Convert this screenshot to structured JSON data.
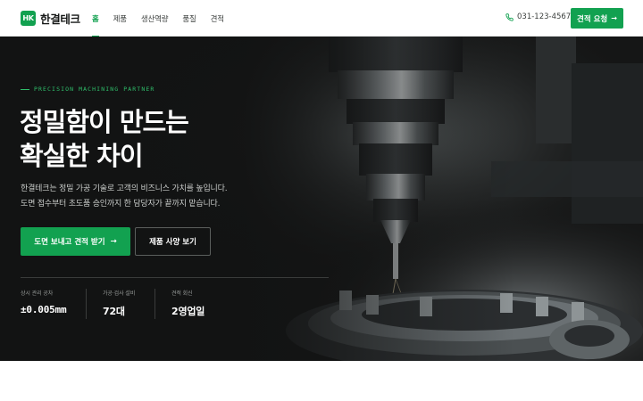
{
  "header": {
    "logo_mark": "HK",
    "brand": "한결테크",
    "nav": [
      {
        "label": "홈",
        "active": true
      },
      {
        "label": "제품",
        "active": false
      },
      {
        "label": "생산역량",
        "active": false
      },
      {
        "label": "품질",
        "active": false
      },
      {
        "label": "견적",
        "active": false
      }
    ],
    "phone": "031-123-4567",
    "quote_button": "견적 요청",
    "icons": {
      "phone": "phone-icon",
      "arrow": "arrow-right-icon"
    }
  },
  "hero": {
    "eyebrow": "PRECISION MACHINING PARTNER",
    "headline_line1": "정밀함이 만드는",
    "headline_line2": "확실한 차이",
    "sub_line1": "한결테크는 정밀 가공 기술로 고객의 비즈니스 가치를 높입니다.",
    "sub_line2": "도면 접수부터 초도품 승인까지 한 담당자가 끝까지 맡습니다.",
    "primary_cta": "도면 보내고 견적 받기",
    "secondary_cta": "제품 사양 보기",
    "stats": [
      {
        "label": "상시 관리 공차",
        "value": "±0.005mm"
      },
      {
        "label": "가공·검사 설비",
        "value": "72대"
      },
      {
        "label": "견적 회신",
        "value": "2영업일"
      }
    ],
    "background": "cnc-machine-spindle-photo"
  },
  "colors": {
    "accent": "#12a150",
    "accent_light": "#2fbf6b",
    "hero_bg": "#141515"
  }
}
